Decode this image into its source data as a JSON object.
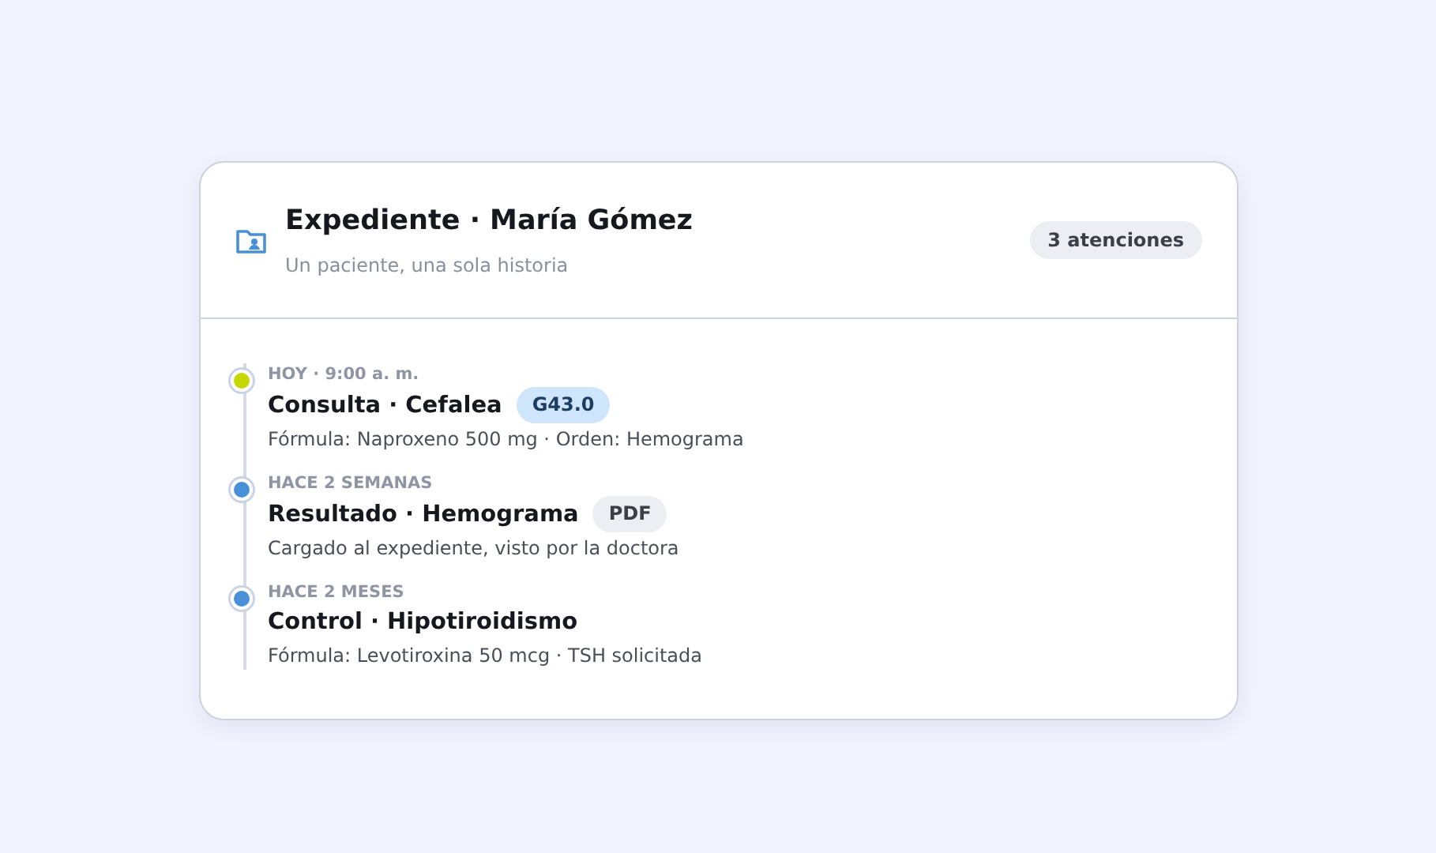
{
  "header": {
    "title": "Expediente · María Gómez",
    "subtitle": "Un paciente, una sola historia",
    "badge": "3 atenciones"
  },
  "timeline": [
    {
      "when": "HOY · 9:00 a. m.",
      "title": "Consulta · Cefalea",
      "color": "#c5d800",
      "tag": {
        "kind": "code",
        "label": "G43.0"
      },
      "detail": "Fórmula: Naproxeno 500 mg · Orden: Hemograma"
    },
    {
      "when": "HACE 2 SEMANAS",
      "title": "Resultado · Hemograma",
      "color": "#4a90d9",
      "tag": {
        "kind": "file",
        "label": "PDF"
      },
      "detail": "Cargado al expediente, visto por la doctora"
    },
    {
      "when": "HACE 2 MESES",
      "title": "Control · Hipotiroidismo",
      "color": "#4a90d9",
      "detail": "Fórmula: Levotiroxina 50 mcg · TSH solicitada"
    }
  ]
}
